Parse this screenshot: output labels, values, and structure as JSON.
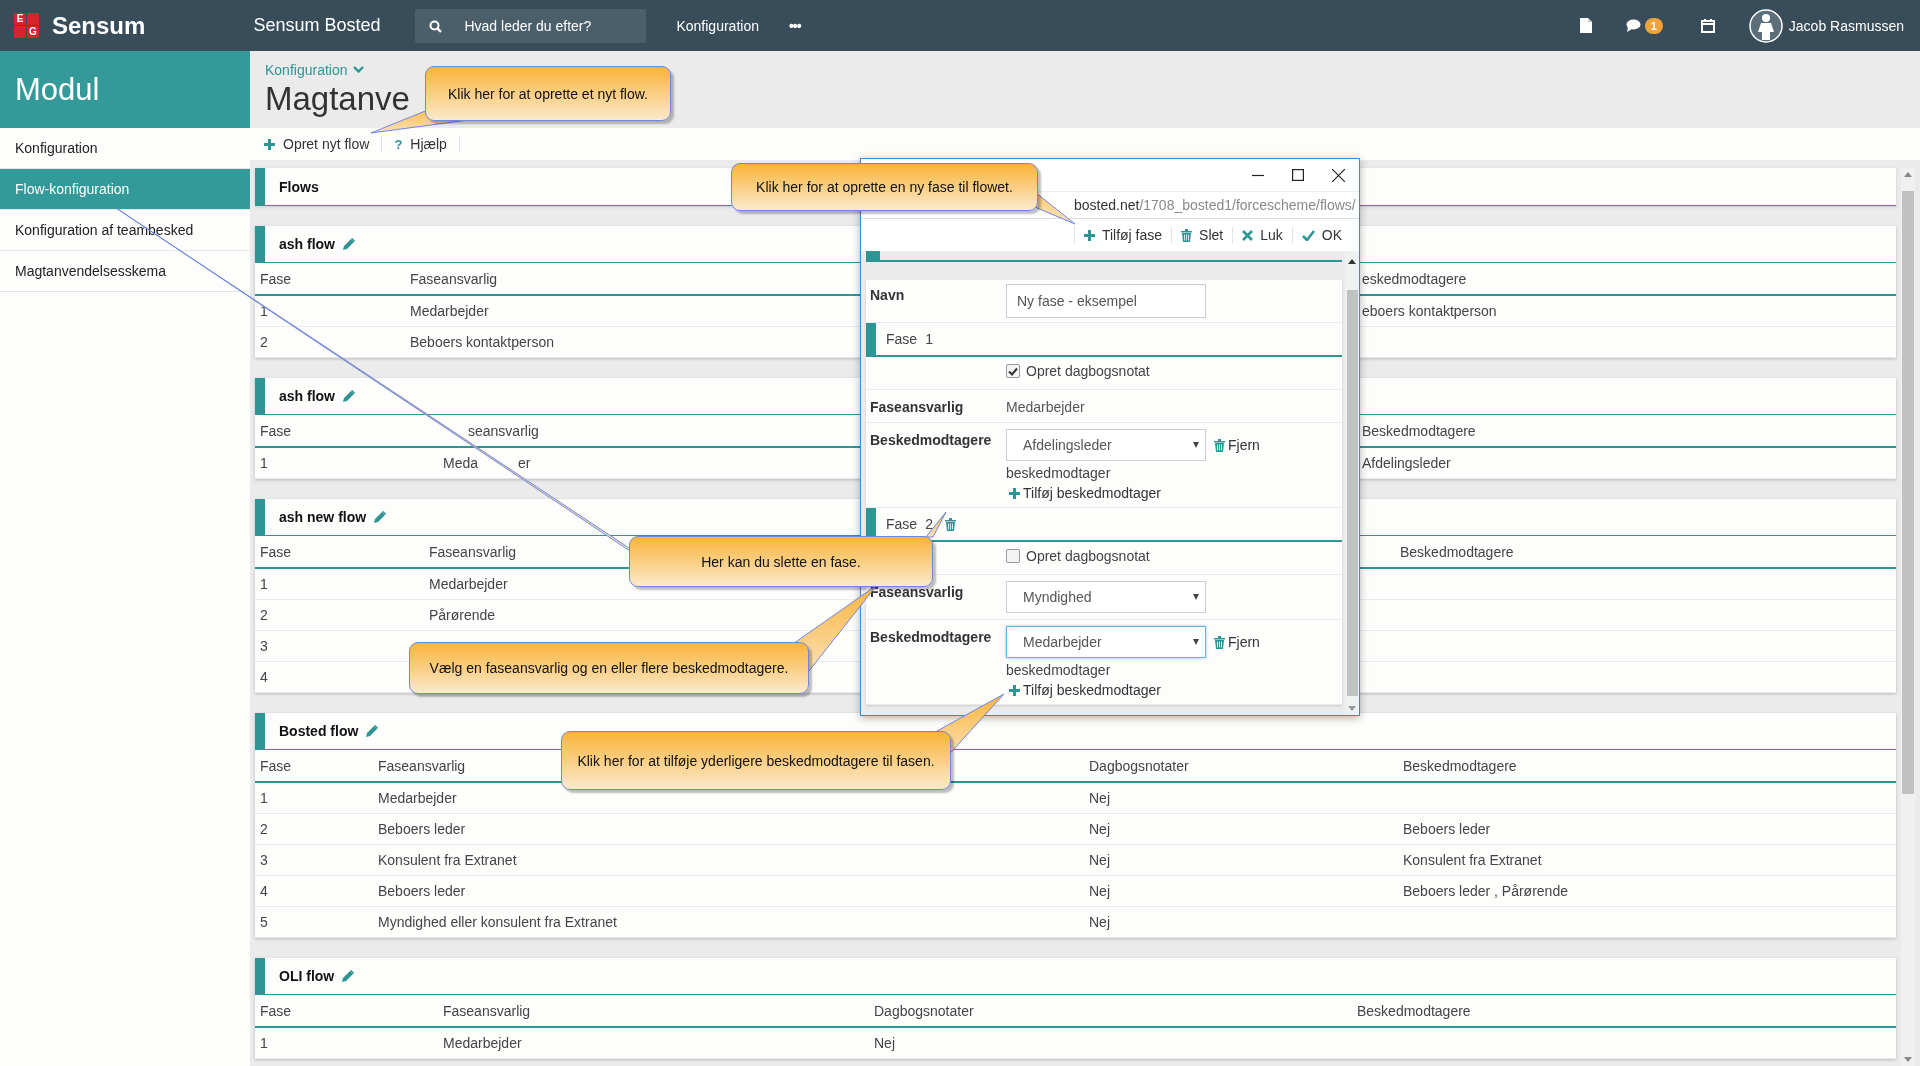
{
  "topbar": {
    "logo_letters": [
      "E",
      "G"
    ],
    "brand": "Sensum",
    "app_name": "Sensum Bosted",
    "search": {
      "placeholder": "Hvad leder du efter?"
    },
    "nav": "Konfiguration",
    "more": "•••",
    "badge": "1",
    "user": "Jacob Rasmussen"
  },
  "sidebar": {
    "title": "Modul",
    "items": [
      {
        "label": "Konfiguration",
        "selected": false
      },
      {
        "label": "Flow-konfiguration",
        "selected": true
      },
      {
        "label": "Konfiguration af teambesked",
        "selected": false
      },
      {
        "label": "Magtanvendelsesskema",
        "selected": false
      }
    ]
  },
  "header": {
    "breadcrumb": "Konfiguration",
    "title": "Magtanve"
  },
  "toolbar": [
    {
      "kind": "add",
      "label": "Opret nyt flow"
    },
    {
      "kind": "help",
      "icon": "?",
      "label": "Hjælp"
    }
  ],
  "flows_header": "Flows",
  "flows": [
    {
      "title": "ash flow",
      "columns": {
        "fase": "Fase",
        "faseansvarlig": "Faseansvarlig",
        "beskedmodtagere": "eskedmodtagere"
      },
      "rows": [
        {
          "fase": "1",
          "faseansvarlig": "Medarbejder",
          "beskedmodtagere": "eboers kontaktperson"
        },
        {
          "fase": "2",
          "faseansvarlig": "Beboers kontaktperson"
        }
      ]
    },
    {
      "title": "ash flow",
      "columns": {
        "fase": "Fase",
        "faseansvarlig": "seansvarlig",
        "beskedmodtagere": "Beskedmodtagere"
      },
      "rows": [
        {
          "fase": "1",
          "faseansvarlig": "Meda",
          "faseansvarlig_tail": "er",
          "beskedmodtagere": "Afdelingsleder"
        }
      ]
    },
    {
      "title": "ash new flow",
      "columns": {
        "fase": "Fase",
        "faseansvarlig": "Faseansvarlig",
        "beskedmodtagere": "Beskedmodtagere"
      },
      "rows": [
        {
          "fase": "1",
          "faseansvarlig": "Medarbejder"
        },
        {
          "fase": "2",
          "faseansvarlig": "Pårørende"
        },
        {
          "fase": "3"
        },
        {
          "fase": "4"
        }
      ]
    },
    {
      "title": "Bosted flow",
      "columns": {
        "fase": "Fase",
        "faseansvarlig": "Faseansvarlig",
        "dagbogsnotater": "Dagbogsnotater",
        "beskedmodtagere": "Beskedmodtagere"
      },
      "rows": [
        {
          "fase": "1",
          "faseansvarlig": "Medarbejder",
          "dagbogsnotater": "Nej"
        },
        {
          "fase": "2",
          "faseansvarlig": "Beboers leder",
          "dagbogsnotater": "Nej",
          "beskedmodtagere": "Beboers leder"
        },
        {
          "fase": "3",
          "faseansvarlig": "Konsulent fra Extranet",
          "dagbogsnotater": "Nej",
          "beskedmodtagere": "Konsulent fra Extranet"
        },
        {
          "fase": "4",
          "faseansvarlig": "Beboers leder",
          "dagbogsnotater": "Nej",
          "beskedmodtagere": "Beboers leder , Pårørende"
        },
        {
          "fase": "5",
          "faseansvarlig": "Myndighed eller konsulent fra Extranet",
          "dagbogsnotater": "Nej"
        }
      ]
    },
    {
      "title": "OLI flow",
      "columns": {
        "fase": "Fase",
        "faseansvarlig": "Faseansvarlig",
        "dagbogsnotater": "Dagbogsnotater",
        "beskedmodtagere": "Beskedmodtagere"
      },
      "rows": [
        {
          "fase": "1",
          "faseansvarlig": "Medarbejder",
          "dagbogsnotater": "Nej"
        }
      ]
    }
  ],
  "dialog": {
    "url_host": "bosted.net",
    "url_path": "/1708_bosted1/forcescheme/flows/",
    "actions": [
      {
        "kind": "add",
        "label": "Tilføj fase"
      },
      {
        "kind": "delete",
        "label": "Slet"
      },
      {
        "kind": "close",
        "label": "Luk"
      },
      {
        "kind": "ok",
        "label": "OK"
      }
    ],
    "name_label": "Navn",
    "name_value": "Ny fase - eksempel",
    "phases": [
      {
        "label": "Fase",
        "number": "1",
        "deletable": false,
        "diary_checked": true,
        "diary_label": "Opret dagbogsnotat",
        "responsible_label": "Faseansvarlig",
        "responsible": {
          "kind": "text",
          "value": "Medarbejder"
        },
        "recipients_label": "Beskedmodtagere",
        "recipients": [
          {
            "value": "Afdelingsleder",
            "focused": false,
            "remove": "Fjern"
          }
        ],
        "recipient_caption": "beskedmodtager",
        "add_recipient": "Tilføj beskedmodtager"
      },
      {
        "label": "Fase",
        "number": "2",
        "deletable": true,
        "diary_checked": false,
        "diary_label": "Opret dagbogsnotat",
        "responsible_label": "Faseansvarlig",
        "responsible": {
          "kind": "select",
          "value": "Myndighed"
        },
        "recipients_label": "Beskedmodtagere",
        "recipients": [
          {
            "value": "Medarbejder",
            "focused": true,
            "remove": "Fjern"
          }
        ],
        "recipient_caption": "beskedmodtager",
        "add_recipient": "Tilføj beskedmodtager"
      }
    ]
  },
  "callouts": [
    {
      "text": "Klik her for at oprette et nyt flow."
    },
    {
      "text": "Klik her for at oprette en ny fase til flowet."
    },
    {
      "text": "Her kan du slette en fase."
    },
    {
      "text": "Vælg en faseansvarlig og en eller flere beskedmodtagere."
    },
    {
      "text": "Klik her for at tilføje yderligere beskedmodtagere til fasen."
    }
  ]
}
